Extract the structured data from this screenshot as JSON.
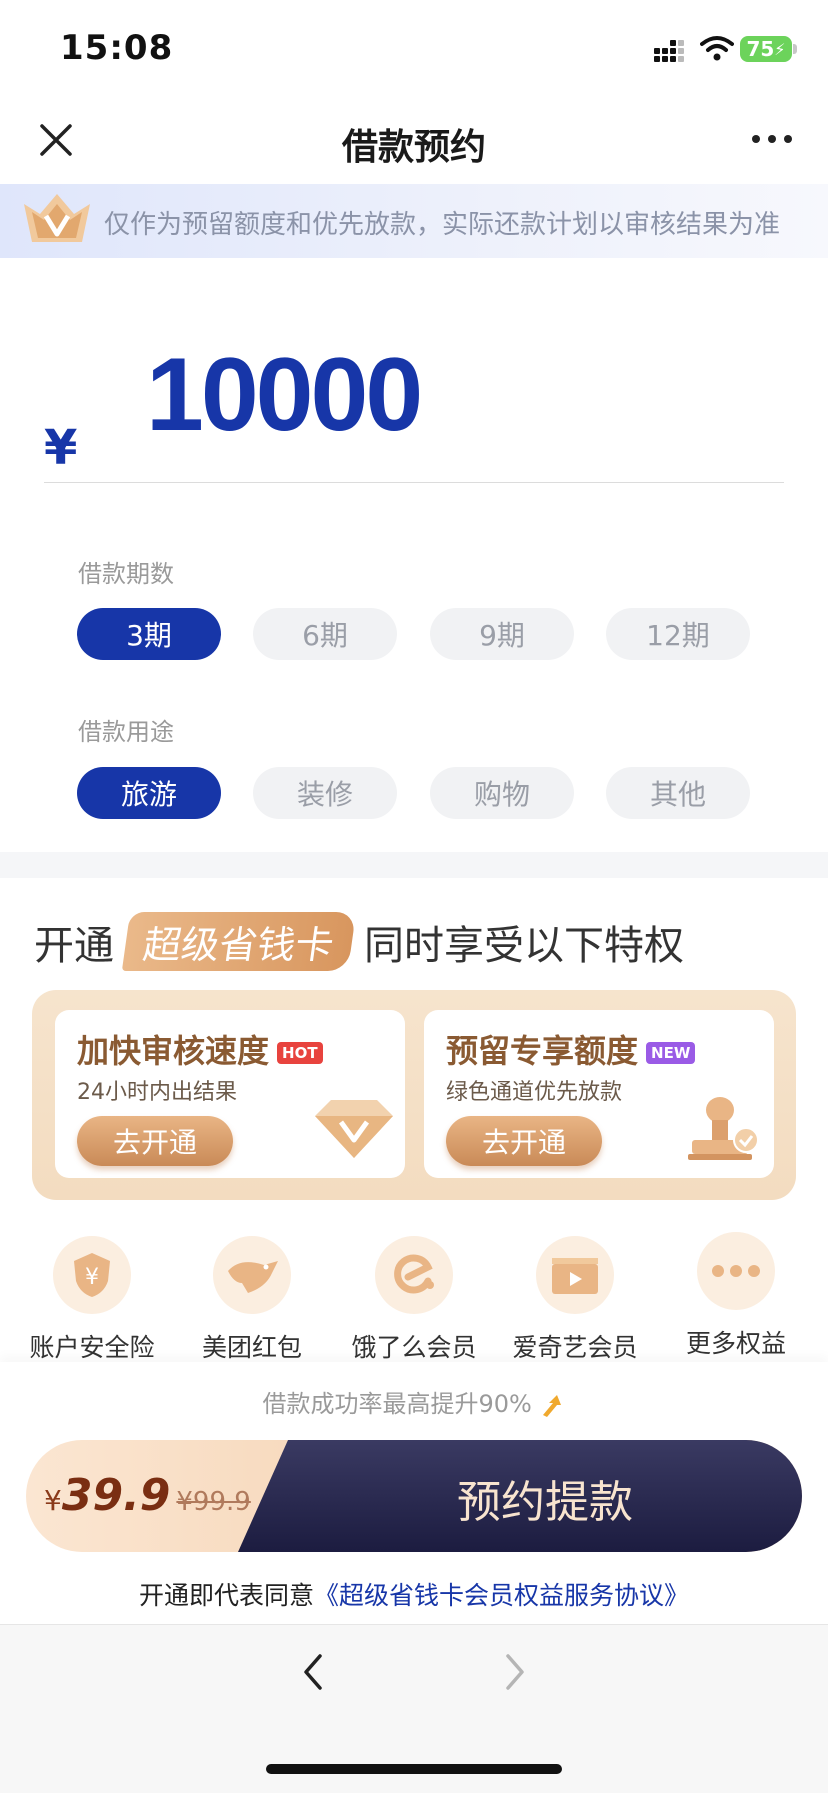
{
  "status_bar": {
    "time": "15:08",
    "battery": "75"
  },
  "nav": {
    "title": "借款预约"
  },
  "banner": {
    "text": "仅作为预留额度和优先放款，实际还款计划以审核结果为准"
  },
  "amount": {
    "currency": "¥",
    "value": "10000"
  },
  "period": {
    "label": "借款期数",
    "options": [
      "3期",
      "6期",
      "9期",
      "12期"
    ],
    "selected": "3期"
  },
  "purpose": {
    "label": "借款用途",
    "options": [
      "旅游",
      "装修",
      "购物",
      "其他"
    ],
    "selected": "旅游"
  },
  "promo": {
    "prefix": "开通",
    "card_name": "超级省钱卡",
    "suffix": "同时享受以下特权",
    "cards": [
      {
        "title": "加快审核速度",
        "badge": "HOT",
        "subtitle": "24小时内出结果",
        "button": "去开通"
      },
      {
        "title": "预留专享额度",
        "badge": "NEW",
        "subtitle": "绿色通道优先放款",
        "button": "去开通"
      }
    ]
  },
  "benefits": [
    {
      "label": "账户安全险",
      "icon": "shield-yen-icon"
    },
    {
      "label": "美团红包",
      "icon": "kangaroo-icon"
    },
    {
      "label": "饿了么会员",
      "icon": "eleme-icon"
    },
    {
      "label": "爱奇艺会员",
      "icon": "video-icon"
    },
    {
      "label": "更多权益",
      "icon": "more-icon"
    }
  ],
  "footer": {
    "success_text": "借款成功率最高提升90%",
    "price_currency": "¥",
    "price": "39.9",
    "original_price": "¥99.9",
    "cta_label": "预约提款",
    "agreement_prefix": "开通即代表同意",
    "agreement_link": "《超级省钱卡会员权益服务协议》"
  },
  "colors": {
    "primary": "#1736a8",
    "gold": "#d8965e",
    "cta_dark": "#23234a"
  }
}
